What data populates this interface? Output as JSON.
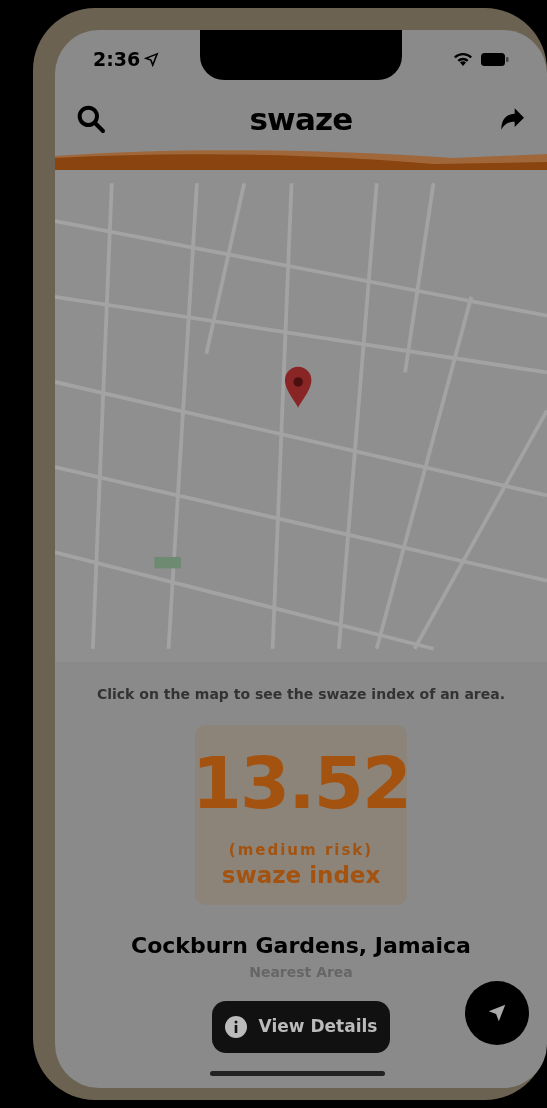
{
  "status_bar": {
    "time": "2:36"
  },
  "header": {
    "title": "swaze"
  },
  "hint": "Click on the map to see the swaze index of an area.",
  "score": {
    "value": "13.52",
    "risk": "(medium risk)",
    "label": "swaze index"
  },
  "location": {
    "name": "Cockburn Gardens, Jamaica",
    "subtitle": "Nearest Area"
  },
  "details_button": {
    "label": "View Details"
  }
}
